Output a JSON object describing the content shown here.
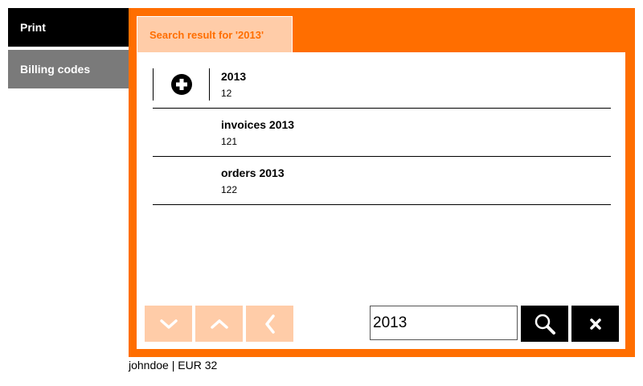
{
  "sidebar": {
    "items": [
      {
        "label": "Print",
        "state": "active"
      },
      {
        "label": "Billing codes",
        "state": "inactive"
      }
    ]
  },
  "panel": {
    "tab_label": "Search result for '2013'",
    "results": [
      {
        "title": "2013",
        "code": "12",
        "action_icon": "plus-circle-icon"
      },
      {
        "title": "invoices 2013",
        "code": "121"
      },
      {
        "title": "orders 2013",
        "code": "122"
      }
    ]
  },
  "toolbar": {
    "down_icon": "chevron-down-icon",
    "up_icon": "chevron-up-icon",
    "back_icon": "chevron-left-icon",
    "search_value": "2013",
    "search_icon": "magnifier-icon",
    "clear_icon": "close-icon"
  },
  "footer": {
    "status": "johndoe | EUR 32"
  },
  "colors": {
    "accent": "#ff6e00",
    "accent_light": "#ffcca8",
    "sidebar_active": "#000000",
    "sidebar_inactive": "#7a7a7a"
  }
}
